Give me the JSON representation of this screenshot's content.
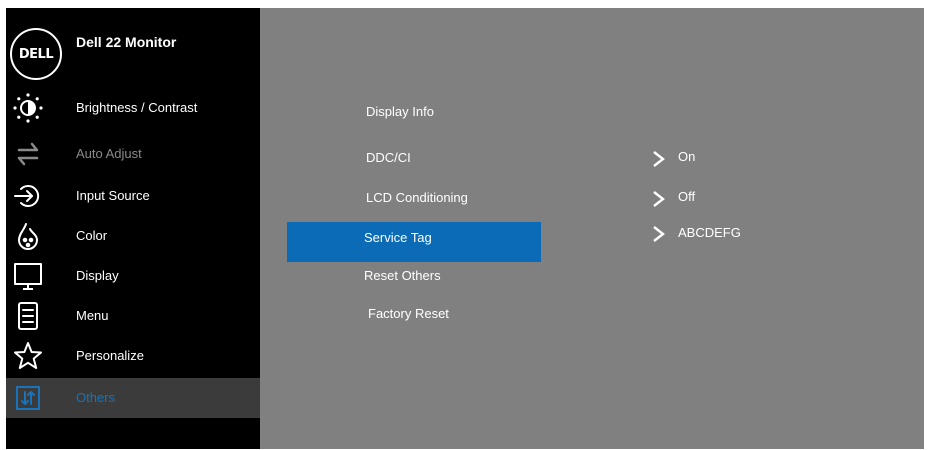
{
  "header": {
    "logo_text": "DELL",
    "title": "Dell 22 Monitor"
  },
  "sidebar": {
    "items": [
      {
        "label": "Brightness / Contrast",
        "icon": "brightness-icon",
        "state": "normal"
      },
      {
        "label": "Auto Adjust",
        "icon": "auto-adjust-icon",
        "state": "disabled"
      },
      {
        "label": "Input Source",
        "icon": "input-source-icon",
        "state": "normal"
      },
      {
        "label": "Color",
        "icon": "color-palette-icon",
        "state": "normal"
      },
      {
        "label": "Display",
        "icon": "display-icon",
        "state": "normal"
      },
      {
        "label": "Menu",
        "icon": "menu-icon",
        "state": "normal"
      },
      {
        "label": "Personalize",
        "icon": "star-icon",
        "state": "normal"
      },
      {
        "label": "Others",
        "icon": "others-icon",
        "state": "selected"
      }
    ]
  },
  "submenu": {
    "items": [
      {
        "label": "Display Info"
      },
      {
        "label": "DDC/CI"
      },
      {
        "label": "LCD Conditioning"
      },
      {
        "label": "Service Tag",
        "selected": true
      },
      {
        "label": "Reset Others"
      },
      {
        "label": "Factory Reset"
      }
    ]
  },
  "values": {
    "ddc_ci": "On",
    "lcd_conditioning": "Off",
    "service_tag": "ABCDEFG"
  },
  "colors": {
    "sidebar_bg": "#000000",
    "main_bg": "#808080",
    "highlight": "#0B6BB6",
    "selected_label": "#1A73B8",
    "disabled_text": "#8A8A8A"
  }
}
